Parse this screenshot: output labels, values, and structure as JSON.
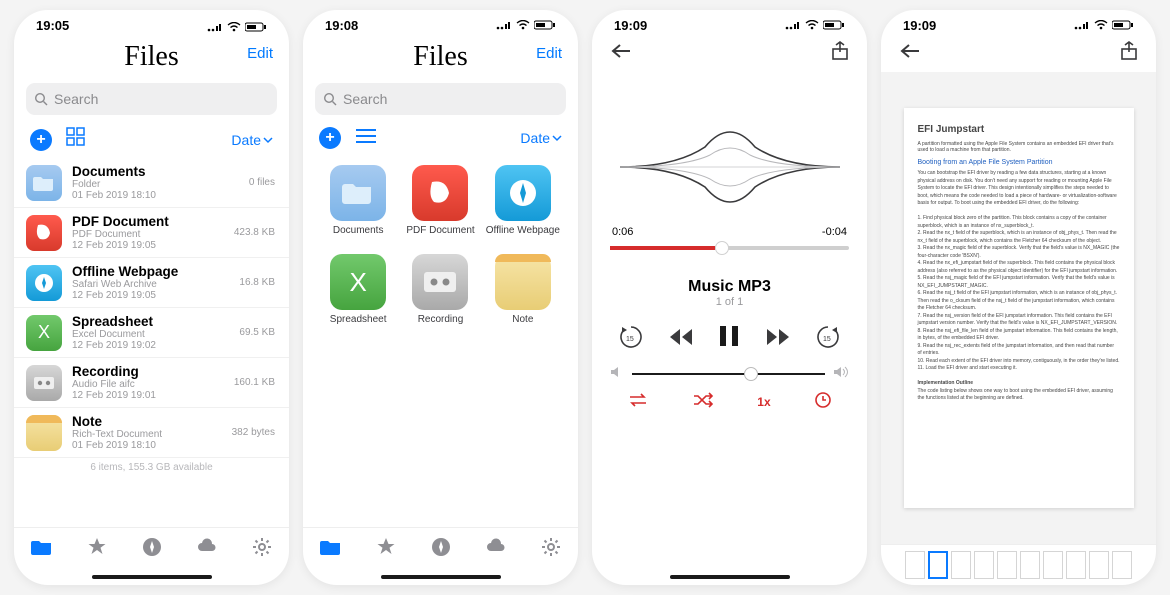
{
  "screens": {
    "list": {
      "time": "19:05",
      "app_title": "Files",
      "edit": "Edit",
      "search_placeholder": "Search",
      "sort_label": "Date",
      "files": [
        {
          "name": "Documents",
          "kind": "Folder",
          "date": "01 Feb 2019 18:10",
          "size": "0 files",
          "type": "folder"
        },
        {
          "name": "PDF Document",
          "kind": "PDF Document",
          "date": "12 Feb 2019 19:05",
          "size": "423.8 KB",
          "type": "pdf"
        },
        {
          "name": "Offline Webpage",
          "kind": "Safari Web Archive",
          "date": "12 Feb 2019 19:05",
          "size": "16.8 KB",
          "type": "web"
        },
        {
          "name": "Spreadsheet",
          "kind": "Excel Document",
          "date": "12 Feb 2019 19:02",
          "size": "69.5 KB",
          "type": "xls"
        },
        {
          "name": "Recording",
          "kind": "Audio File aifc",
          "date": "12 Feb 2019 19:01",
          "size": "160.1 KB",
          "type": "rec"
        },
        {
          "name": "Note",
          "kind": "Rich-Text Document",
          "date": "01 Feb 2019 18:10",
          "size": "382 bytes",
          "type": "note"
        }
      ],
      "summary": "6 items, 155.3 GB available"
    },
    "grid": {
      "time": "19:08",
      "app_title": "Files",
      "edit": "Edit",
      "search_placeholder": "Search",
      "sort_label": "Date",
      "items": [
        {
          "label": "Documents",
          "type": "folder"
        },
        {
          "label": "PDF Document",
          "type": "pdf"
        },
        {
          "label": "Offline Webpage",
          "type": "web"
        },
        {
          "label": "Spreadsheet",
          "type": "xls"
        },
        {
          "label": "Recording",
          "type": "rec"
        },
        {
          "label": "Note",
          "type": "note"
        }
      ]
    },
    "player": {
      "time": "19:09",
      "elapsed": "0:06",
      "remaining": "-0:04",
      "track_name": "Music MP3",
      "track_index": "1 of 1",
      "speed": "1x"
    },
    "doc": {
      "time": "19:09",
      "page_title": "EFI Jumpstart",
      "section_heading": "Booting from an Apple File System Partition"
    }
  }
}
